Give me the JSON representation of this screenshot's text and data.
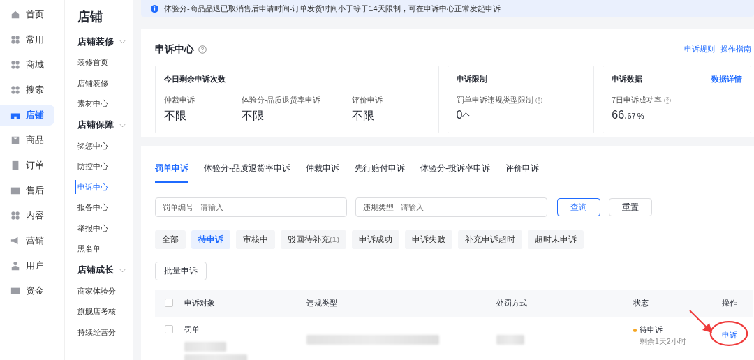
{
  "nav": {
    "items": [
      {
        "label": "首页",
        "selected": false
      },
      {
        "label": "常用",
        "selected": false
      },
      {
        "label": "商城",
        "selected": false
      },
      {
        "label": "搜索",
        "selected": false
      },
      {
        "label": "店铺",
        "selected": true
      },
      {
        "label": "商品",
        "selected": false
      },
      {
        "label": "订单",
        "selected": false
      },
      {
        "label": "售后",
        "selected": false
      },
      {
        "label": "内容",
        "selected": false
      },
      {
        "label": "营销",
        "selected": false
      },
      {
        "label": "用户",
        "selected": false
      },
      {
        "label": "资金",
        "selected": false
      }
    ]
  },
  "submenu": {
    "title": "店铺",
    "groups": [
      {
        "label": "店铺装修",
        "expanded": true,
        "children": [
          {
            "label": "装修首页",
            "selected": false
          },
          {
            "label": "店铺装修",
            "selected": false
          },
          {
            "label": "素材中心",
            "selected": false
          }
        ]
      },
      {
        "label": "店铺保障",
        "expanded": true,
        "children": [
          {
            "label": "奖惩中心",
            "selected": false
          },
          {
            "label": "防控中心",
            "selected": false
          },
          {
            "label": "申诉中心",
            "selected": true
          },
          {
            "label": "报备中心",
            "selected": false
          },
          {
            "label": "举报中心",
            "selected": false
          },
          {
            "label": "黑名单",
            "selected": false
          }
        ]
      },
      {
        "label": "店铺成长",
        "expanded": true,
        "children": [
          {
            "label": "商家体验分",
            "selected": false
          },
          {
            "label": "旗舰店考核",
            "selected": false
          },
          {
            "label": "持续经营分",
            "selected": false
          }
        ]
      }
    ]
  },
  "notice": "体验分-商品品退已取消售后申请时间-订单发货时间小于等于14天限制，可在申诉中心正常发起申诉",
  "header": {
    "title": "申诉中心",
    "links": [
      "申诉规则",
      "操作指南"
    ]
  },
  "quota": {
    "title": "今日剩余申诉次数",
    "stats": [
      {
        "label": "仲裁申诉",
        "value": "不限"
      },
      {
        "label": "体验分-品质退货率申诉",
        "value": "不限"
      },
      {
        "label": "评价申诉",
        "value": "不限"
      }
    ]
  },
  "limit": {
    "title": "申诉限制",
    "label": "罚单申诉违规类型限制",
    "value": "0",
    "unit": "个"
  },
  "data_card": {
    "title": "申诉数据",
    "link": "数据详情",
    "label": "7日申诉成功率",
    "value": "66.",
    "decimals": "67",
    "unit": "%"
  },
  "tabs": [
    {
      "label": "罚单申诉",
      "selected": true
    },
    {
      "label": "体验分-品质退货率申诉",
      "selected": false
    },
    {
      "label": "仲裁申诉",
      "selected": false
    },
    {
      "label": "先行赔付申诉",
      "selected": false
    },
    {
      "label": "体验分-投诉率申诉",
      "selected": false
    },
    {
      "label": "评价申诉",
      "selected": false
    }
  ],
  "filters": [
    {
      "label": "罚单编号",
      "placeholder": "请输入"
    },
    {
      "label": "违规类型",
      "placeholder": "请输入"
    }
  ],
  "buttons": {
    "query": "查询",
    "reset": "重置",
    "batch": "批量申诉"
  },
  "chips": [
    {
      "label": "全部",
      "selected": false
    },
    {
      "label": "待申诉",
      "selected": true
    },
    {
      "label": "审核中",
      "selected": false
    },
    {
      "label": "驳回待补充",
      "count": "(1)",
      "selected": false
    },
    {
      "label": "申诉成功",
      "selected": false
    },
    {
      "label": "申诉失败",
      "selected": false
    },
    {
      "label": "补充申诉超时",
      "selected": false
    },
    {
      "label": "超时未申诉",
      "selected": false
    }
  ],
  "table": {
    "columns": [
      "申诉对象",
      "违规类型",
      "处罚方式",
      "状态",
      "操作"
    ],
    "select_all_checked": false,
    "rows": [
      {
        "checked": false,
        "object": "罚单",
        "status": "待申诉",
        "color": "#f5a623",
        "remaining": "剩余1天2小时",
        "action": "申诉"
      }
    ]
  }
}
